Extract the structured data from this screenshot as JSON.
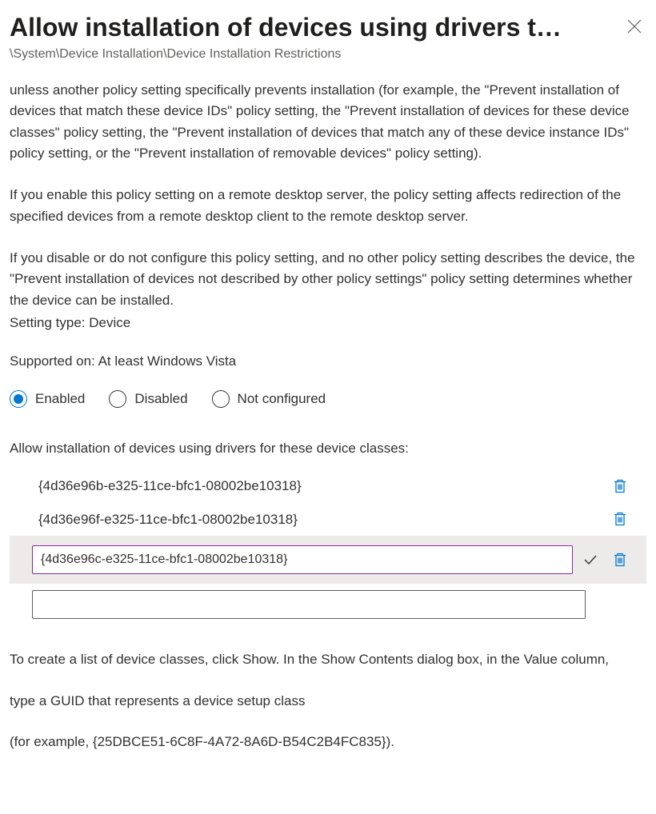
{
  "header": {
    "title": "Allow installation of devices using drivers t…",
    "breadcrumb": "\\System\\Device Installation\\Device Installation Restrictions"
  },
  "description": {
    "p1": "unless another policy setting specifically prevents installation (for example, the \"Prevent installation of devices that match these device IDs\" policy setting, the \"Prevent installation of devices for these device classes\" policy setting, the \"Prevent installation of devices that match any of these device instance IDs\" policy setting, or the \"Prevent installation of removable devices\" policy setting).",
    "p2": "If you enable this policy setting on a remote desktop server, the policy setting affects redirection of the specified devices from a remote desktop client to the remote desktop server.",
    "p3": "If you disable or do not configure this policy setting, and no other policy setting describes the device, the \"Prevent installation of devices not described by other policy settings\" policy setting determines whether the device can be installed."
  },
  "meta": {
    "setting_type": "Setting type: Device",
    "supported_on": "Supported on: At least Windows Vista"
  },
  "state": {
    "options": [
      "Enabled",
      "Disabled",
      "Not configured"
    ],
    "selected": "Enabled"
  },
  "list": {
    "label": "Allow installation of devices using drivers for these device classes:",
    "items": [
      {
        "value": "{4d36e96b-e325-11ce-bfc1-08002be10318}",
        "editing": false
      },
      {
        "value": "{4d36e96f-e325-11ce-bfc1-08002be10318}",
        "editing": false
      },
      {
        "value": "{4d36e96c-e325-11ce-bfc1-08002be10318}",
        "editing": true
      }
    ],
    "new_value": ""
  },
  "footer": {
    "p1": "To create a list of device classes, click Show. In the Show Contents dialog box, in the Value column,",
    "p2": "type a GUID that represents a device setup class",
    "p3": "(for example, {25DBCE51-6C8F-4A72-8A6D-B54C2B4FC835})."
  }
}
